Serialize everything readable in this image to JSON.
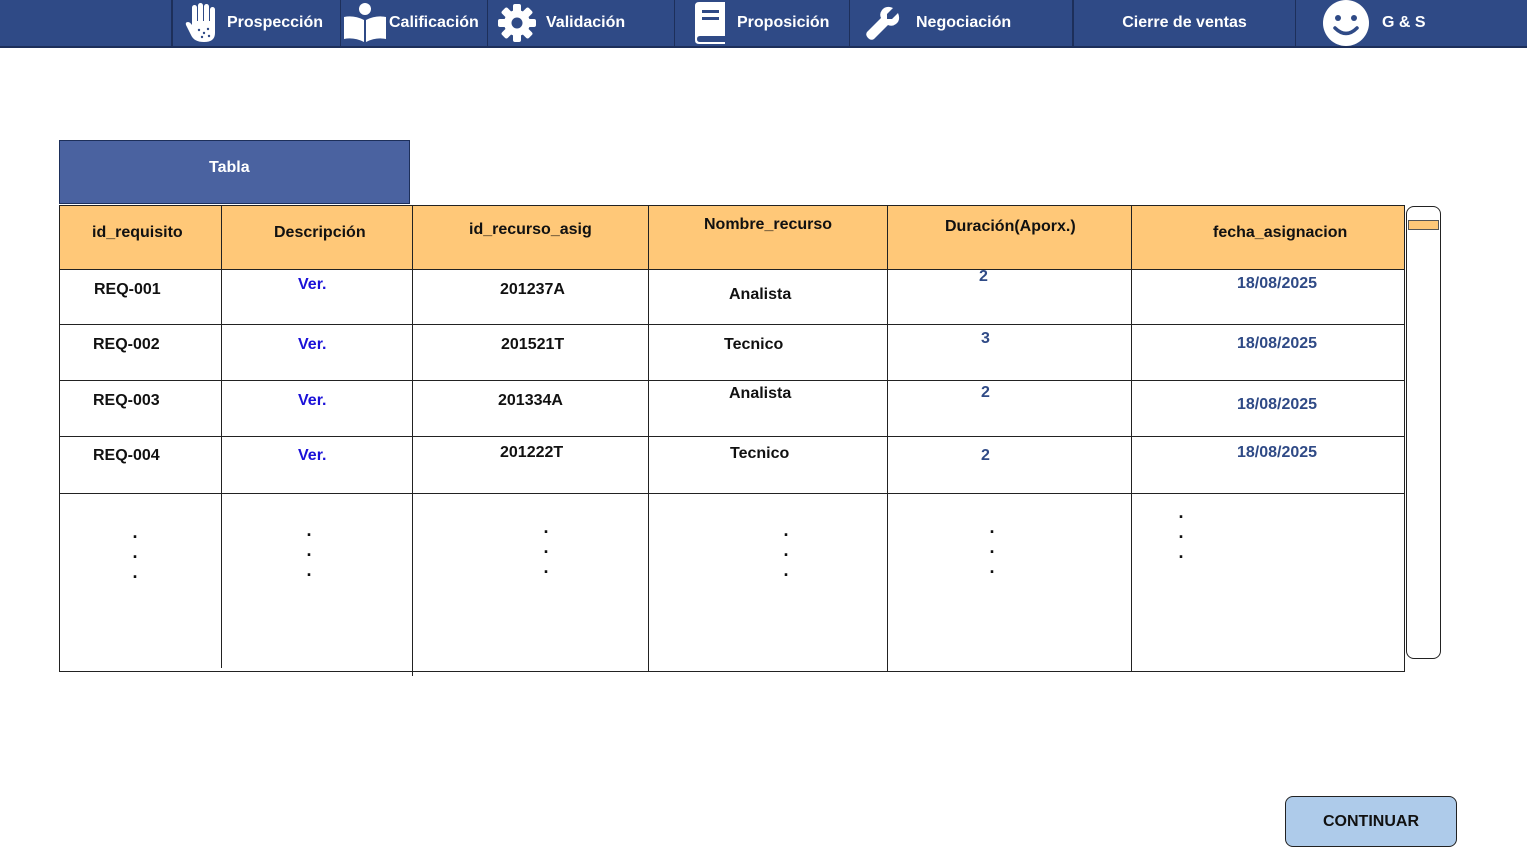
{
  "nav": {
    "items": [
      {
        "label": "Prospección",
        "icon": "hand-icon"
      },
      {
        "label": "Calificación",
        "icon": "reader-icon"
      },
      {
        "label": "Validación",
        "icon": "gear-icon"
      },
      {
        "label": "Proposición",
        "icon": "book-icon"
      },
      {
        "label": "Negociación",
        "icon": "wrench-icon"
      },
      {
        "label": "Cierre de ventas",
        "icon": ""
      }
    ],
    "brand": {
      "label": "G & S",
      "icon": "smiley-icon"
    }
  },
  "tab": {
    "label": "Tabla"
  },
  "table": {
    "headers": [
      "id_requisito",
      "Descripción",
      "id_recurso_asig",
      "Nombre_recurso",
      "Duración(Aporx.)",
      "fecha_asignacion"
    ],
    "rows": [
      {
        "id": "REQ-001",
        "desc": "Ver.",
        "recurso": "201237A",
        "nombre": "Analista",
        "duracion": "2",
        "fecha": "18/08/2025"
      },
      {
        "id": "REQ-002",
        "desc": "Ver.",
        "recurso": "201521T",
        "nombre": "Tecnico",
        "duracion": "3",
        "fecha": "18/08/2025"
      },
      {
        "id": "REQ-003",
        "desc": "Ver.",
        "recurso": "201334A",
        "nombre": "Analista",
        "duracion": "2",
        "fecha": "18/08/2025"
      },
      {
        "id": "REQ-004",
        "desc": "Ver.",
        "recurso": "201222T",
        "nombre": "Tecnico",
        "duracion": "2",
        "fecha": "18/08/2025"
      }
    ],
    "ellipsis": "."
  },
  "actions": {
    "continue_label": "CONTINUAR"
  },
  "colors": {
    "nav": "#2f4a86",
    "header": "#ffc878",
    "tab": "#4a62a0",
    "button": "#aecbea",
    "link": "#1a10d8"
  }
}
